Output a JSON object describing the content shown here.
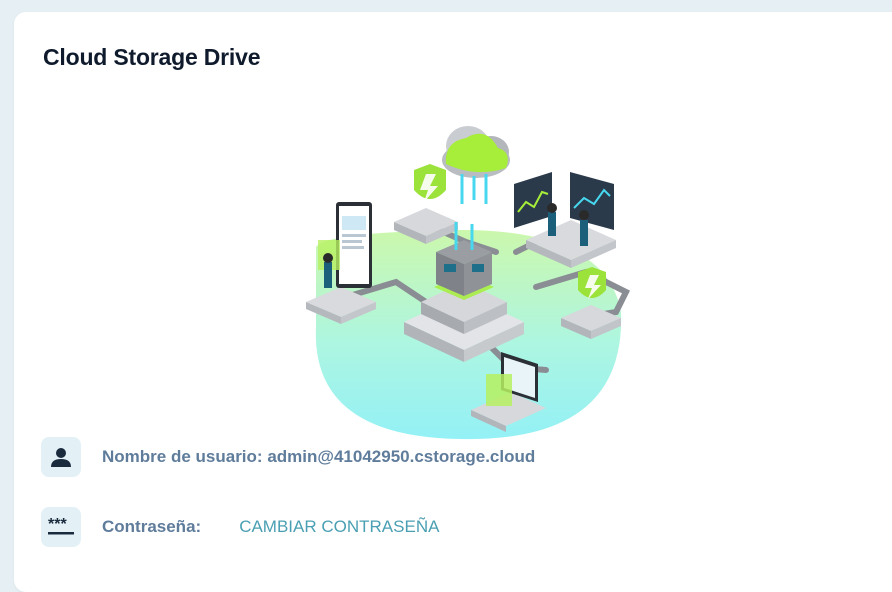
{
  "card": {
    "title": "Cloud Storage Drive"
  },
  "account": {
    "username_label": "Nombre de usuario:",
    "username_value": "admin@41042950.cstorage.cloud",
    "password_label": "Contraseña:",
    "change_password_link": "CAMBIAR CONTRASEÑA"
  },
  "icons": {
    "user": "person-icon",
    "password": "password-dots-icon",
    "illustration": "cloud-storage-illustration"
  },
  "colors": {
    "title": "#0f1b2d",
    "label": "#5f7c9b",
    "link": "#4a9fb3",
    "icon_bg": "#e3f1f6",
    "accent_green": "#a6f03a",
    "accent_cyan": "#6ee6f0"
  }
}
